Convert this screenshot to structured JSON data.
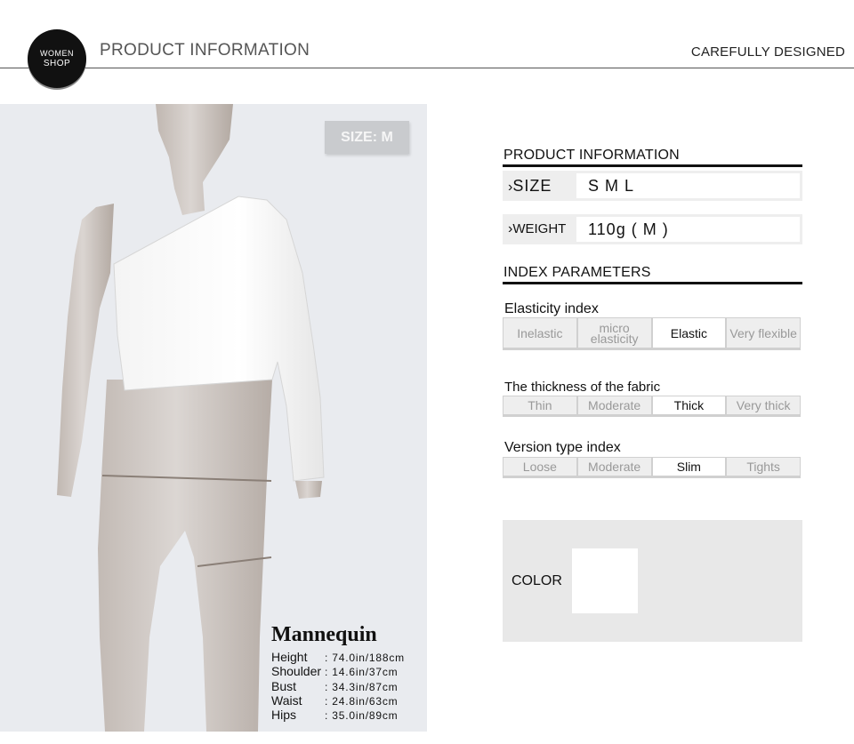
{
  "header": {
    "logo_line1": "WOMEN",
    "logo_line2": "SHOP",
    "title": "PRODUCT INFORMATION",
    "tagline": "CAREFULLY DESIGNED"
  },
  "photo": {
    "size_badge": "SIZE: M",
    "mannequin": {
      "title": "Mannequin",
      "measurements": [
        {
          "label": "Height",
          "value": ": 74.0in/188cm"
        },
        {
          "label": "Shoulder",
          "value": ": 14.6in/37cm"
        },
        {
          "label": "Bust",
          "value": ": 34.3in/87cm"
        },
        {
          "label": "Waist",
          "value": ": 24.8in/63cm"
        },
        {
          "label": "Hips",
          "value": ": 35.0in/89cm"
        }
      ]
    }
  },
  "product_info": {
    "title": "PRODUCT INFORMATION",
    "size_label": "SIZE",
    "size_value": "S M L",
    "weight_label": "WEIGHT",
    "weight_value": "110g ( M )"
  },
  "index_parameters": {
    "title": "INDEX PARAMETERS",
    "elasticity": {
      "label": "Elasticity index",
      "options": [
        "Inelastic",
        "micro elasticity",
        "Elastic",
        "Very flexible"
      ],
      "selected": "Elastic"
    },
    "thickness": {
      "label": "The thickness of the fabric",
      "options": [
        "Thin",
        "Moderate",
        "Thick",
        "Very thick"
      ],
      "selected": "Thick"
    },
    "version": {
      "label": "Version type index",
      "options": [
        "Loose",
        "Moderate",
        "Slim",
        "Tights"
      ],
      "selected": "Slim"
    }
  },
  "color": {
    "label": "COLOR",
    "swatch": "#ffffff"
  }
}
